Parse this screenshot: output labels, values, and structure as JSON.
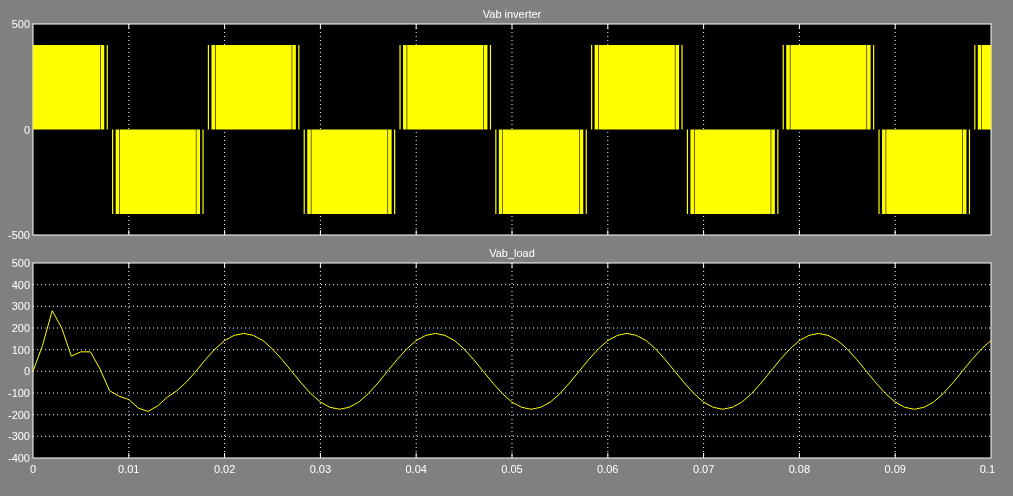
{
  "scopes": [
    {
      "title": "Vab inverter",
      "yticks": [
        "500",
        "0",
        "-500"
      ]
    },
    {
      "title": "Vab_load",
      "chart_data": {
        "type": "line",
        "grid": true,
        "xlim": [
          0,
          0.1
        ],
        "ylim": [
          -400,
          500
        ],
        "xticks": [
          0,
          0.01,
          0.02,
          0.03,
          0.04,
          0.05,
          0.06,
          0.07,
          0.08,
          0.09,
          {
            "value": 0.1,
            "label": "0.1"
          }
        ],
        "yticks": [
          500,
          400,
          300,
          200,
          100,
          0,
          -100,
          -200,
          -300,
          -400
        ],
        "x": [
          0,
          0.001,
          0.002,
          0.003,
          0.004,
          0.005,
          0.006,
          0.007,
          0.008,
          0.009,
          0.01,
          0.011,
          0.012,
          0.013,
          0.014,
          0.015,
          0.016,
          0.017,
          0.018,
          0.019,
          0.02,
          0.021,
          0.022,
          0.023,
          0.024,
          0.025,
          0.026,
          0.027,
          0.028,
          0.029,
          0.03,
          0.031,
          0.032,
          0.033,
          0.034,
          0.035,
          0.036,
          0.037,
          0.038,
          0.039,
          0.04,
          0.041,
          0.042,
          0.043,
          0.044,
          0.045,
          0.046,
          0.047,
          0.048,
          0.049,
          0.05,
          0.051,
          0.052,
          0.053,
          0.054,
          0.055,
          0.056,
          0.057,
          0.058,
          0.059,
          0.06,
          0.061,
          0.062,
          0.063,
          0.064,
          0.065,
          0.066,
          0.067,
          0.068,
          0.069,
          0.07,
          0.071,
          0.072,
          0.073,
          0.074,
          0.075,
          0.076,
          0.077,
          0.078,
          0.079,
          0.08,
          0.081,
          0.082,
          0.083,
          0.084,
          0.085,
          0.086,
          0.087,
          0.088,
          0.089,
          0.09,
          0.091,
          0.092,
          0.093,
          0.094,
          0.095,
          0.096,
          0.097,
          0.098,
          0.099,
          0.1
        ],
        "series": [
          {
            "color": "#ffff00",
            "values": [
              0,
              120,
              280,
              200,
              70,
              90,
              90,
              10,
              -90,
              -115,
              -130,
              -170,
              -185,
              -160,
              -120,
              -90,
              -50,
              0,
              54,
              103,
              142,
              166,
              175,
              166,
              142,
              103,
              54,
              0,
              -54,
              -103,
              -142,
              -166,
              -175,
              -166,
              -142,
              -103,
              -54,
              0,
              54,
              103,
              142,
              166,
              175,
              166,
              142,
              103,
              54,
              0,
              -54,
              -103,
              -142,
              -166,
              -175,
              -166,
              -142,
              -103,
              -54,
              0,
              54,
              103,
              142,
              166,
              175,
              166,
              142,
              103,
              54,
              0,
              -54,
              -103,
              -142,
              -166,
              -175,
              -166,
              -142,
              -103,
              -54,
              0,
              54,
              103,
              142,
              166,
              175,
              166,
              142,
              103,
              54,
              0,
              -54,
              -103,
              -142,
              -166,
              -175,
              -166,
              -142,
              -103,
              -54,
              0,
              54,
              103,
              142
            ]
          }
        ]
      }
    }
  ]
}
